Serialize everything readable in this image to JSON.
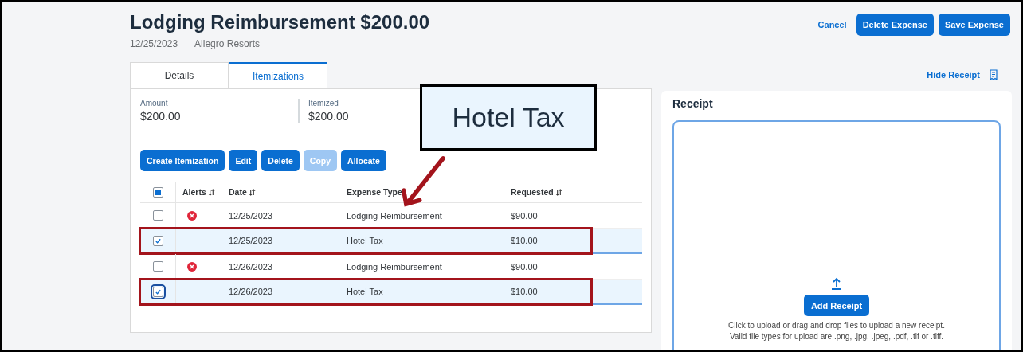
{
  "header": {
    "title": "Lodging Reimbursement $200.00",
    "date": "12/25/2023",
    "vendor": "Allegro Resorts",
    "actions": [
      {
        "label": "Cancel",
        "kind": "link"
      },
      {
        "label": "Delete Expense",
        "kind": "button"
      },
      {
        "label": "Save Expense",
        "kind": "button"
      }
    ]
  },
  "tabs": [
    {
      "label": "Details",
      "selected": false
    },
    {
      "label": "Itemizations",
      "selected": true
    }
  ],
  "summary": [
    {
      "label": "Amount",
      "value": "$200.00"
    },
    {
      "label": "Itemized",
      "value": "$200.00"
    }
  ],
  "toolbar": [
    {
      "label": "Create Itemization",
      "disabled": false
    },
    {
      "label": "Edit",
      "disabled": false
    },
    {
      "label": "Delete",
      "disabled": false
    },
    {
      "label": "Copy",
      "disabled": true
    },
    {
      "label": "Allocate",
      "disabled": false
    }
  ],
  "table": {
    "select_all": {
      "indeterminate": true
    },
    "columns": [
      "Alerts",
      "Date",
      "Expense Type",
      "Requested"
    ],
    "rows": [
      {
        "checked": false,
        "alert": true,
        "date": "12/25/2023",
        "expense_type": "Lodging Reimbursement",
        "requested": "$90.00",
        "highlighted": false,
        "focused": false
      },
      {
        "checked": true,
        "alert": false,
        "date": "12/25/2023",
        "expense_type": "Hotel Tax",
        "requested": "$10.00",
        "highlighted": true,
        "focused": false
      },
      {
        "checked": false,
        "alert": true,
        "date": "12/26/2023",
        "expense_type": "Lodging Reimbursement",
        "requested": "$90.00",
        "highlighted": false,
        "focused": false
      },
      {
        "checked": true,
        "alert": false,
        "date": "12/26/2023",
        "expense_type": "Hotel Tax",
        "requested": "$10.00",
        "highlighted": true,
        "focused": true
      }
    ]
  },
  "receipt": {
    "hide_label": "Hide Receipt",
    "title": "Receipt",
    "button": "Add Receipt",
    "help": [
      "Click to upload or drag and drop files to upload a new receipt.",
      "Valid file types for upload are .png, .jpg, .jpeg, .pdf, .tif or .tiff."
    ]
  },
  "callout": {
    "text": "Hotel Tax"
  }
}
